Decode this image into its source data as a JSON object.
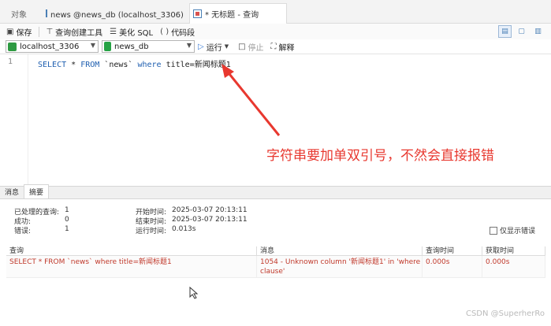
{
  "tabs": {
    "objects": "对象",
    "news_table": "news @news_db (localhost_3306) - 表",
    "query": "* 无标题 - 查询"
  },
  "toolbar": {
    "save": "保存",
    "query_builder": "查询创建工具",
    "beautify_sql": "美化 SQL",
    "code_snippet": "代码段"
  },
  "connection": {
    "server": "localhost_3306",
    "database": "news_db",
    "run": "运行",
    "stop": "停止",
    "explain": "解释"
  },
  "editor": {
    "line_number": "1",
    "kw_select": "SELECT",
    "star": " * ",
    "kw_from": "FROM",
    "table": " `news` ",
    "kw_where": "where",
    "condition": " title=新闻标题1"
  },
  "annotation": {
    "text": "字符串要加单双引号，不然会直接报错",
    "color": "#e8382f"
  },
  "result_tabs": {
    "messages": "消息",
    "summary": "摘要"
  },
  "summary": {
    "processed_label": "已处理的查询:",
    "processed_value": "1",
    "success_label": "成功:",
    "success_value": "0",
    "error_label": "错误:",
    "error_value": "1",
    "start_label": "开始时间:",
    "start_value": "2025-03-07 20:13:11",
    "end_label": "结束时间:",
    "end_value": "2025-03-07 20:13:11",
    "runtime_label": "运行时间:",
    "runtime_value": "0.013s",
    "show_errors_only": "仅显示错误"
  },
  "grid": {
    "headers": [
      "查询",
      "消息",
      "查询时间",
      "获取时间"
    ],
    "rows": [
      {
        "query": "SELECT * FROM `news` where title=新闻标题1",
        "message": "1054 - Unknown column '新闻标题1' in 'where clause'",
        "query_time": "0.000s",
        "fetch_time": "0.000s"
      }
    ]
  },
  "watermark": "CSDN @SuperherRo",
  "colors": {
    "error_text": "#c0392b",
    "keyword": "#1f5fb0",
    "connection_green": "#2e9a42"
  }
}
